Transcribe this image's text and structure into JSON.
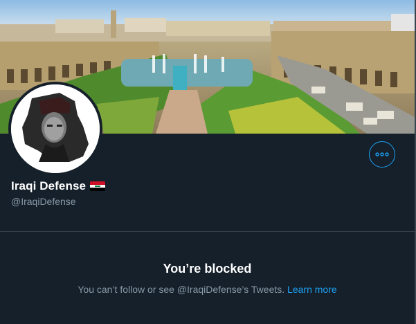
{
  "profile": {
    "display_name": "Iraqi Defense",
    "handle": "@IraqiDefense",
    "flag_icon": "iraq-flag-icon"
  },
  "blocked": {
    "title": "You’re blocked",
    "message_prefix": "You can’t follow or see @IraqiDefense’s Tweets.",
    "learn_more": "Learn more"
  },
  "colors": {
    "background": "#15202b",
    "accent": "#1da1f2",
    "secondary_text": "#8899a6",
    "divider": "#38444d"
  },
  "icons": {
    "more": "more-horizontal-icon",
    "avatar": "avatar-image"
  }
}
